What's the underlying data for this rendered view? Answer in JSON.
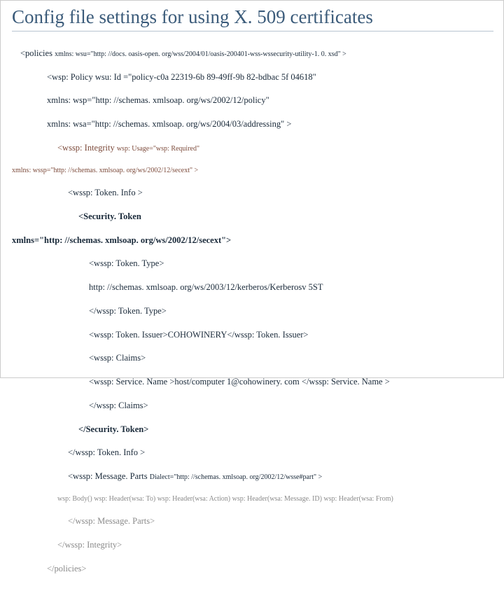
{
  "title": "Config file settings for using X. 509 certificates",
  "lines": {
    "policies_open": "<policies ",
    "policies_ns": "xmlns: wsu=\"http: //docs. oasis-open. org/wss/2004/01/oasis-200401-wss-wssecurity-utility-1. 0. xsd\" >",
    "wsp_policy1": "<wsp: Policy wsu: Id =\"policy-c0a 22319-6b 89-49ff-9b 82-bdbac 5f 04618\"",
    "wsp_policy2": "xmlns: wsp=\"http: //schemas. xmlsoap. org/ws/2002/12/policy\"",
    "wsp_policy3": "xmlns: wsa=\"http: //schemas. xmlsoap. org/ws/2004/03/addressing\" >",
    "integrity_open": "<wssp: Integrity ",
    "integrity_attr": "wsp: Usage=\"wsp: Required\"",
    "integrity_ns": "xmlns: wssp=\"http: //schemas. xmlsoap. org/ws/2002/12/secext\" >",
    "tokeninfo_open": "<wssp: Token. Info >",
    "sectoken_open": "<Security. Token",
    "sectoken_ns": "xmlns=\"http: //schemas. xmlsoap. org/ws/2002/12/secext\">",
    "tokentype_open": "<wssp: Token. Type>",
    "tokentype_val": "http: //schemas. xmlsoap. org/ws/2003/12/kerberos/Kerberosv 5ST",
    "tokentype_close": "</wssp: Token. Type>",
    "issuer": "<wssp: Token. Issuer>COHOWINERY</wssp: Token. Issuer>",
    "claims_open": "<wssp: Claims>",
    "servicename": "<wssp: Service. Name >host/computer 1@cohowinery. com </wssp: Service. Name >",
    "claims_close": "</wssp: Claims>",
    "sectoken_close": "</Security. Token>",
    "tokeninfo_close": "</wssp: Token. Info >",
    "msgparts_open": "<wssp: Message. Parts ",
    "msgparts_attr": "Dialect=\"http: //schemas. xmlsoap. org/2002/12/wsse#part\" >",
    "msgparts_body": "wsp: Body() wsp: Header(wsa: To) wsp: Header(wsa: Action) wsp: Header(wsa: Message. ID) wsp: Header(wsa: From)",
    "msgparts_close": "</wssp: Message. Parts>",
    "integrity_close": "</wssp: Integrity>",
    "policies_close": "</policies>"
  }
}
